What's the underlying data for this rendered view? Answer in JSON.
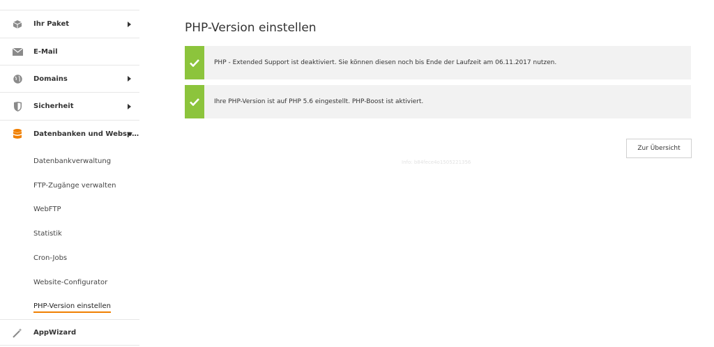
{
  "sidebar": {
    "items": [
      {
        "label": "Ihr Paket",
        "icon": "package-icon"
      },
      {
        "label": "E-Mail",
        "icon": "envelope-icon"
      },
      {
        "label": "Domains",
        "icon": "globe-icon"
      },
      {
        "label": "Sicherheit",
        "icon": "shield-icon"
      },
      {
        "label": "Datenbanken und Websp…",
        "icon": "database-icon"
      },
      {
        "label": "AppWizard",
        "icon": "magic-wand-icon"
      }
    ],
    "subitems": [
      {
        "label": "Datenbankverwaltung"
      },
      {
        "label": "FTP-Zugänge verwalten"
      },
      {
        "label": "WebFTP"
      },
      {
        "label": "Statistik"
      },
      {
        "label": "Cron-Jobs"
      },
      {
        "label": "Website-Configurator"
      },
      {
        "label": "PHP-Version einstellen"
      }
    ]
  },
  "main": {
    "title": "PHP-Version einstellen",
    "alerts": [
      {
        "text": "PHP - Extended Support ist deaktiviert. Sie können diesen noch bis Ende der Laufzeit am 06.11.2017 nutzen."
      },
      {
        "text": "Ihre PHP-Version ist auf PHP 5.6 eingestellt. PHP-Boost ist aktiviert."
      }
    ],
    "back_button": "Zur Übersicht",
    "info": "Info: b84fece4o1505221356"
  },
  "colors": {
    "accent": "#f07f00",
    "success": "#8cc43c",
    "alert_bg": "#f2f2f2"
  }
}
